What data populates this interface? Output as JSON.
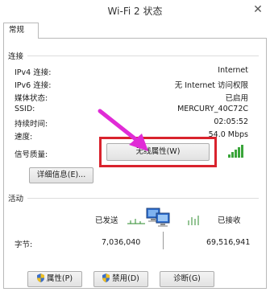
{
  "window": {
    "title": "Wi-Fi 2 状态",
    "close_glyph": "✕"
  },
  "tab": {
    "label": "常规"
  },
  "connection": {
    "section_label": "连接",
    "rows": [
      {
        "label": "IPv4 连接:",
        "value": "Internet"
      },
      {
        "label": "IPv6 连接:",
        "value": "无 Internet 访问权限"
      },
      {
        "label": "媒体状态:",
        "value": "已启用"
      },
      {
        "label": "SSID:",
        "value": "MERCURY_40C72C"
      },
      {
        "label": "持续时间:",
        "value": "02:05:52"
      },
      {
        "label": "速度:",
        "value": "54.0 Mbps"
      }
    ],
    "signal_label": "信号质量:",
    "signal_bars": 5
  },
  "buttons": {
    "details": "详细信息(E)...",
    "wireless_properties": "无线属性(W)",
    "properties": "属性(P)",
    "disable": "禁用(D)",
    "diagnose": "诊断(G)"
  },
  "activity": {
    "section_label": "活动",
    "sent_label": "已发送",
    "received_label": "已接收",
    "bytes_label": "字节:",
    "bytes_sent": "7,036,040",
    "bytes_received": "69,516,941"
  },
  "colors": {
    "highlight": "#d9232d",
    "arrow": "#e02bd6",
    "signal": "#3aa53a",
    "shield_blue": "#3b6fc9",
    "shield_yellow": "#f0c020"
  },
  "icons": {
    "close": "close-icon",
    "signal": "signal-icon",
    "network": "network-computers-icon",
    "arrow": "annotation-arrow-icon",
    "shield": "uac-shield-icon"
  }
}
